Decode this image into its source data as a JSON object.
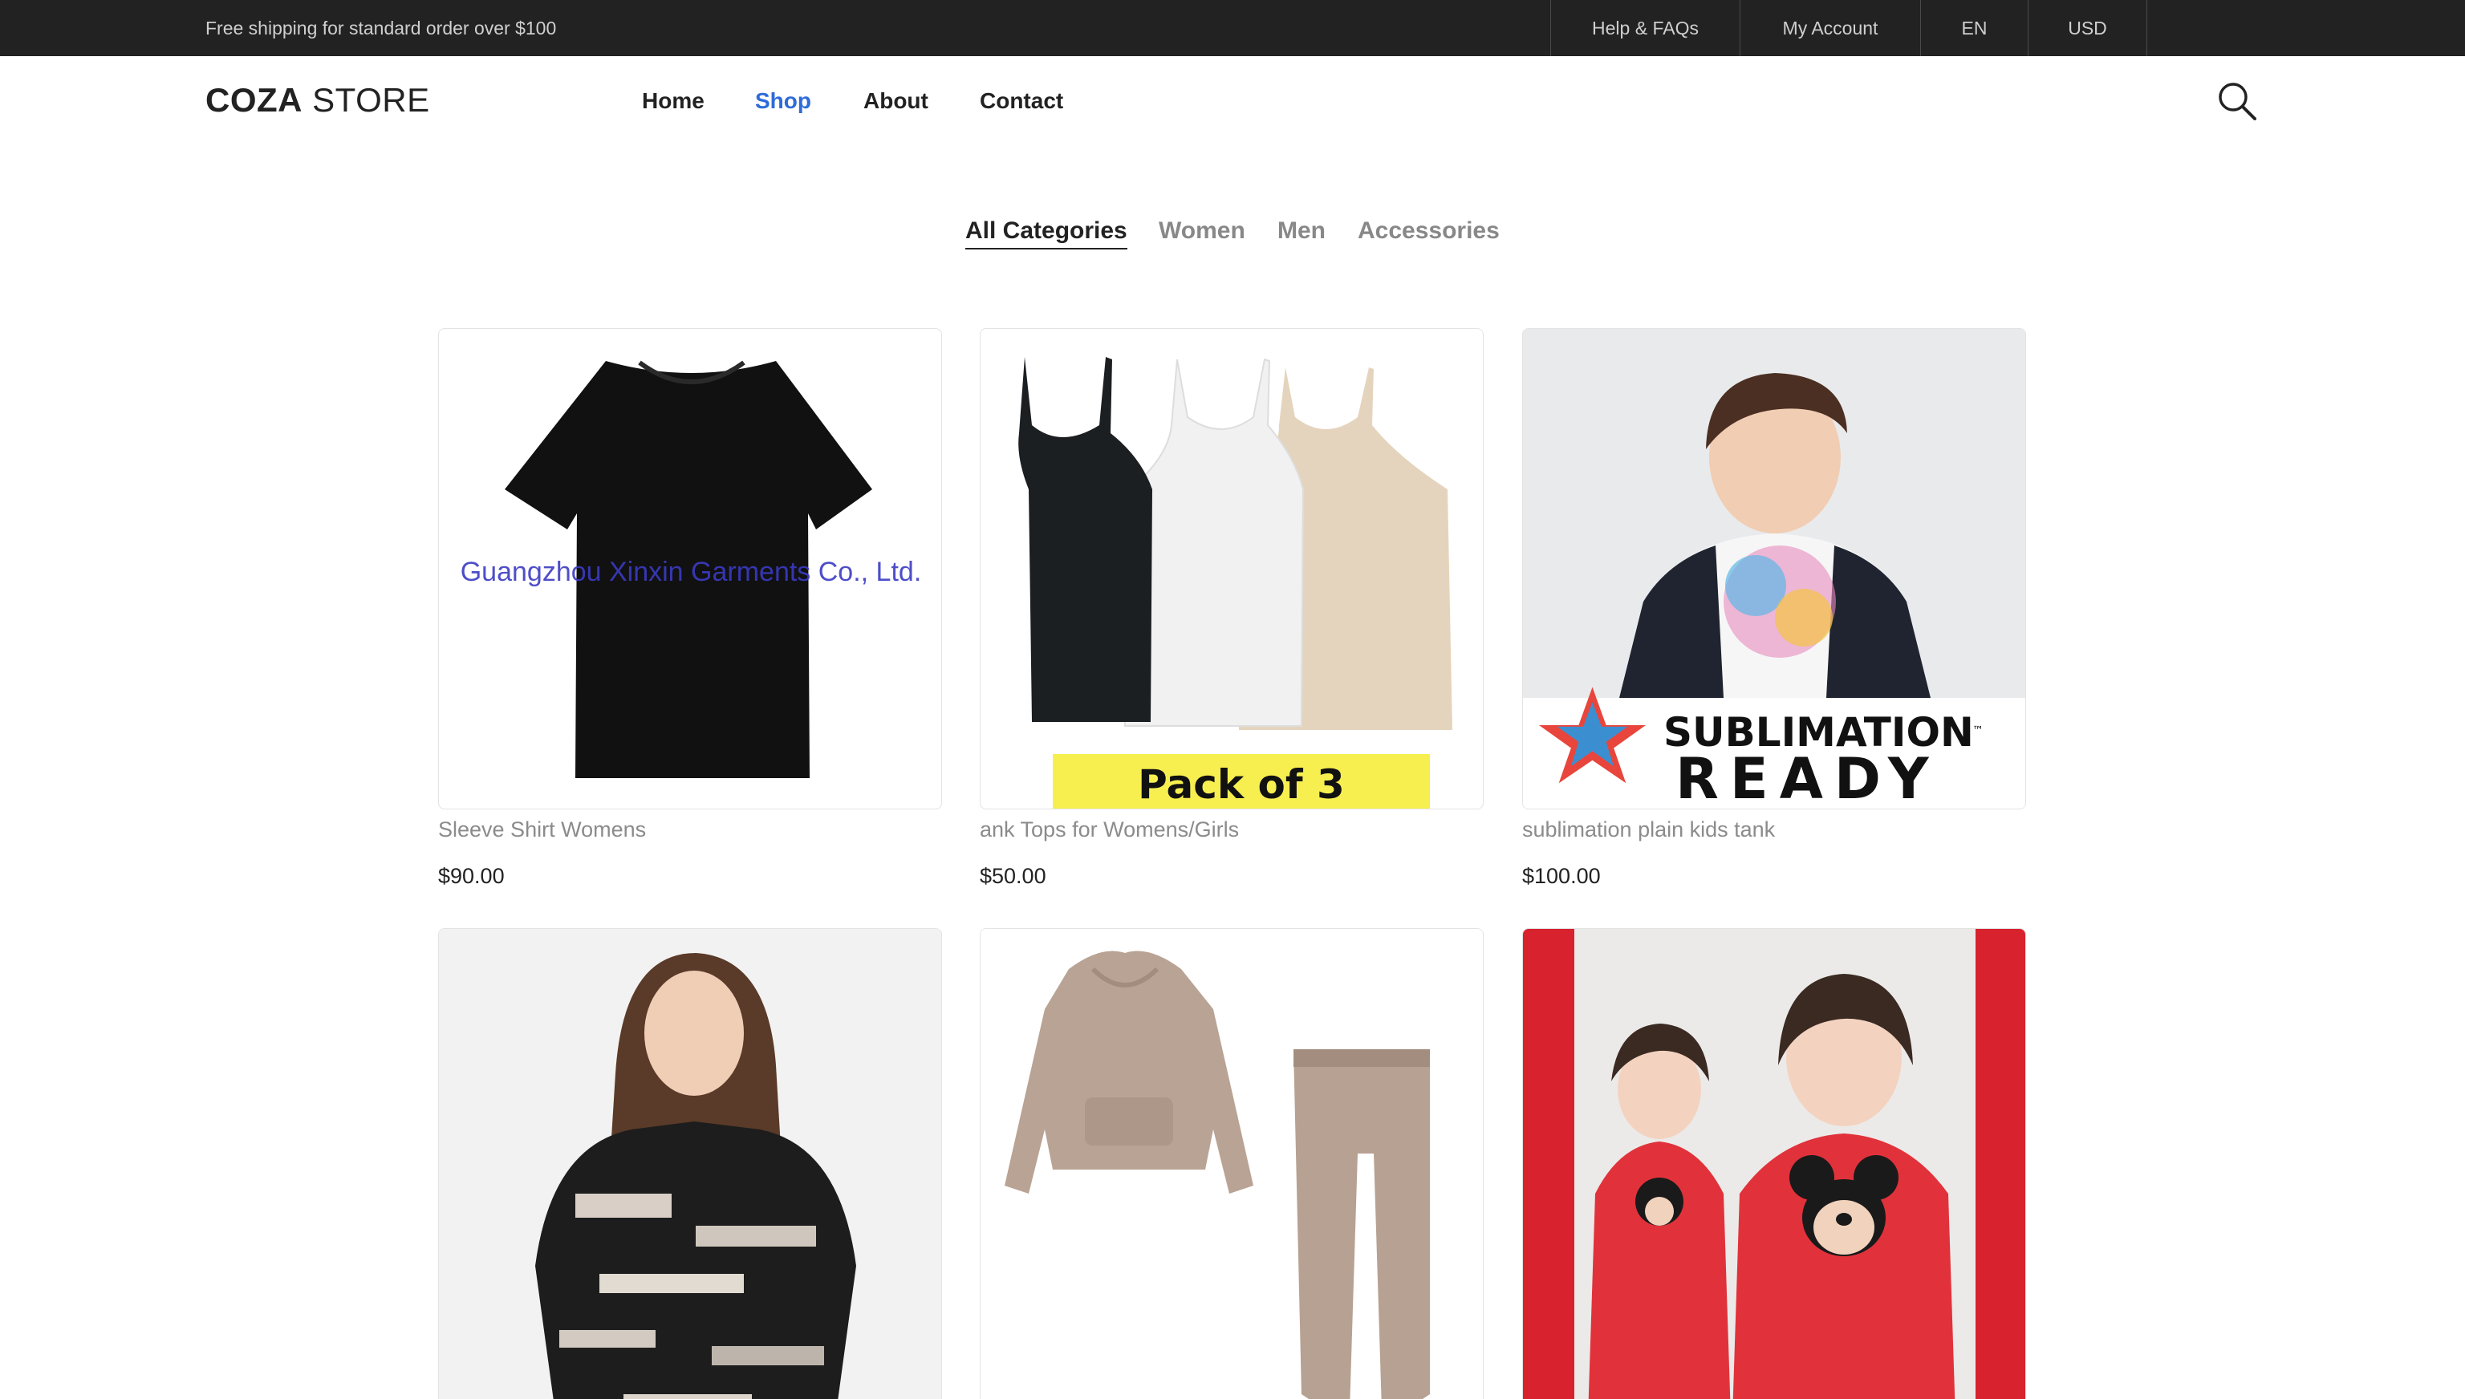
{
  "topbar": {
    "promo": "Free shipping for standard order over $100",
    "links": [
      "Help & FAQs",
      "My Account",
      "EN",
      "USD"
    ]
  },
  "header": {
    "logo_bold": "COZA",
    "logo_light": " STORE",
    "nav": [
      "Home",
      "Shop",
      "About",
      "Contact"
    ],
    "active_nav": "Shop",
    "search_icon": "search-icon"
  },
  "filters": {
    "items": [
      "All Categories",
      "Women",
      "Men",
      "Accessories"
    ],
    "active": "All Categories"
  },
  "products": [
    {
      "name": "Sleeve Shirt Womens",
      "price": "$90.00",
      "watermark": "Guangzhou Xinxin Garments Co., Ltd."
    },
    {
      "name": "ank Tops for Womens/Girls",
      "price": "$50.00",
      "banner": "Pack of 3"
    },
    {
      "name": "sublimation plain kids tank",
      "price": "$100.00",
      "banner_top": "SUBLIMATION",
      "banner_bottom": "READY",
      "banner_mark": "™"
    },
    {
      "name": "",
      "price": ""
    },
    {
      "name": "",
      "price": ""
    },
    {
      "name": "",
      "price": ""
    }
  ],
  "colors": {
    "topbar_bg": "#222222",
    "accent": "#2e6bd9",
    "text": "#222222",
    "muted": "#888888",
    "pack_banner": "#f7ef4f"
  }
}
